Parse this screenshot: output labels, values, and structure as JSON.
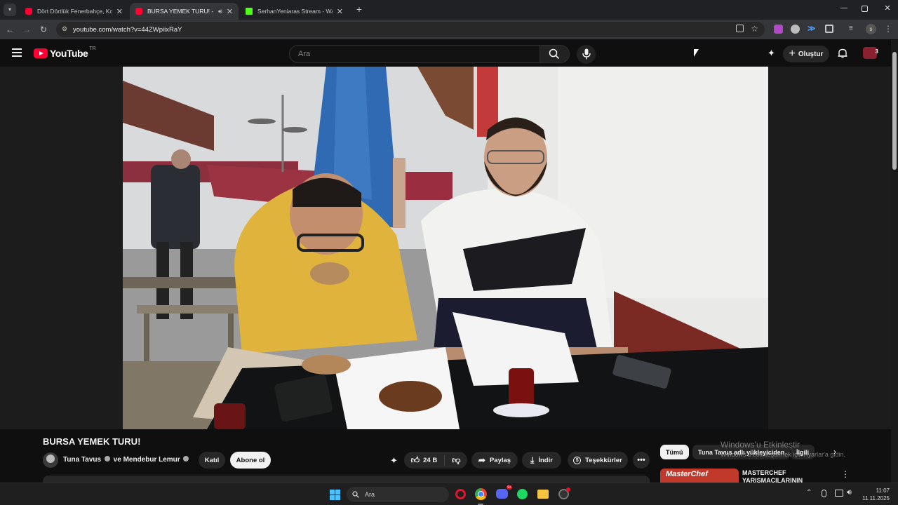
{
  "browser": {
    "tabs": [
      {
        "title": "Dört Dörtlük Fenerbahçe, Kocae",
        "active": false,
        "favicon": "youtube-icon"
      },
      {
        "title": "BURSA YEMEK TURU! - You",
        "active": true,
        "favicon": "youtube-icon",
        "audio": true
      },
      {
        "title": "SerhanYeniaras Stream - Watch",
        "active": false,
        "favicon": "kick-icon"
      }
    ],
    "url": "youtube.com/watch?v=44ZWpiixRaY"
  },
  "youtube": {
    "logo_text": "YouTube",
    "region": "TR",
    "search_placeholder": "Ara",
    "create_label": "Oluştur",
    "notification_count": "3"
  },
  "video": {
    "title": "BURSA YEMEK TURU!",
    "channel": "Tuna Tavus",
    "and_label": "ve",
    "collab": "Mendebur Lemur",
    "join_label": "Katıl",
    "subscribe_label": "Abone ol",
    "likes": "24 B",
    "share_label": "Paylaş",
    "download_label": "İndir",
    "thanks_label": "Teşekkürler"
  },
  "sidebar": {
    "chips": [
      "Tümü",
      "Tuna Tavus adlı yükleyiciden",
      "İlgili"
    ],
    "rec_title": "MASTERCHEF YARIŞMACILARININ",
    "rec_thumb_text": "MasterChef"
  },
  "watermark": {
    "line1": "Windows'u Etkinleştir",
    "line2": "Windows'u etkinleştirmek için Ayarlar'a gidin."
  },
  "taskbar": {
    "search_placeholder": "Ara",
    "time": "11:07",
    "date": "11.11.2025",
    "discord_badge": "9+"
  },
  "colors": {
    "accent": "#ff0033",
    "bg": "#0f0f0f",
    "chrome": "#202124"
  }
}
